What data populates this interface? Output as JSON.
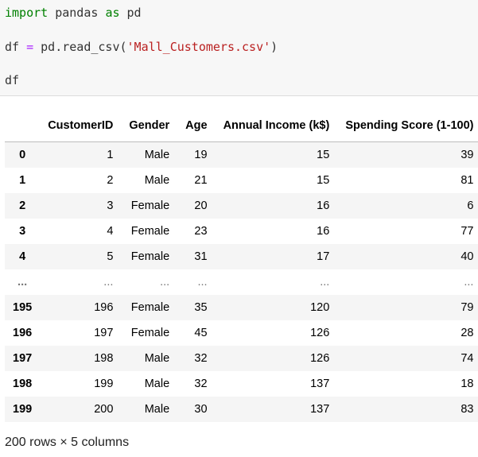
{
  "code": {
    "line1": {
      "kw1": "import",
      "t1": " pandas ",
      "kw2": "as",
      "t2": " pd"
    },
    "line2": {
      "t1": "df ",
      "op": "=",
      "t2": " pd.read_csv(",
      "str": "'Mall_Customers.csv'",
      "t3": ")"
    },
    "line3": "df"
  },
  "table": {
    "columns": [
      "CustomerID",
      "Gender",
      "Age",
      "Annual Income (k$)",
      "Spending Score (1-100)"
    ],
    "rows": [
      {
        "index": "0",
        "cells": [
          "1",
          "Male",
          "19",
          "15",
          "39"
        ]
      },
      {
        "index": "1",
        "cells": [
          "2",
          "Male",
          "21",
          "15",
          "81"
        ]
      },
      {
        "index": "2",
        "cells": [
          "3",
          "Female",
          "20",
          "16",
          "6"
        ]
      },
      {
        "index": "3",
        "cells": [
          "4",
          "Female",
          "23",
          "16",
          "77"
        ]
      },
      {
        "index": "4",
        "cells": [
          "5",
          "Female",
          "31",
          "17",
          "40"
        ]
      },
      {
        "index": "...",
        "cells": [
          "...",
          "...",
          "...",
          "...",
          "..."
        ]
      },
      {
        "index": "195",
        "cells": [
          "196",
          "Female",
          "35",
          "120",
          "79"
        ]
      },
      {
        "index": "196",
        "cells": [
          "197",
          "Female",
          "45",
          "126",
          "28"
        ]
      },
      {
        "index": "197",
        "cells": [
          "198",
          "Male",
          "32",
          "126",
          "74"
        ]
      },
      {
        "index": "198",
        "cells": [
          "199",
          "Male",
          "32",
          "137",
          "18"
        ]
      },
      {
        "index": "199",
        "cells": [
          "200",
          "Male",
          "30",
          "137",
          "83"
        ]
      }
    ]
  },
  "footer": "200 rows × 5 columns"
}
